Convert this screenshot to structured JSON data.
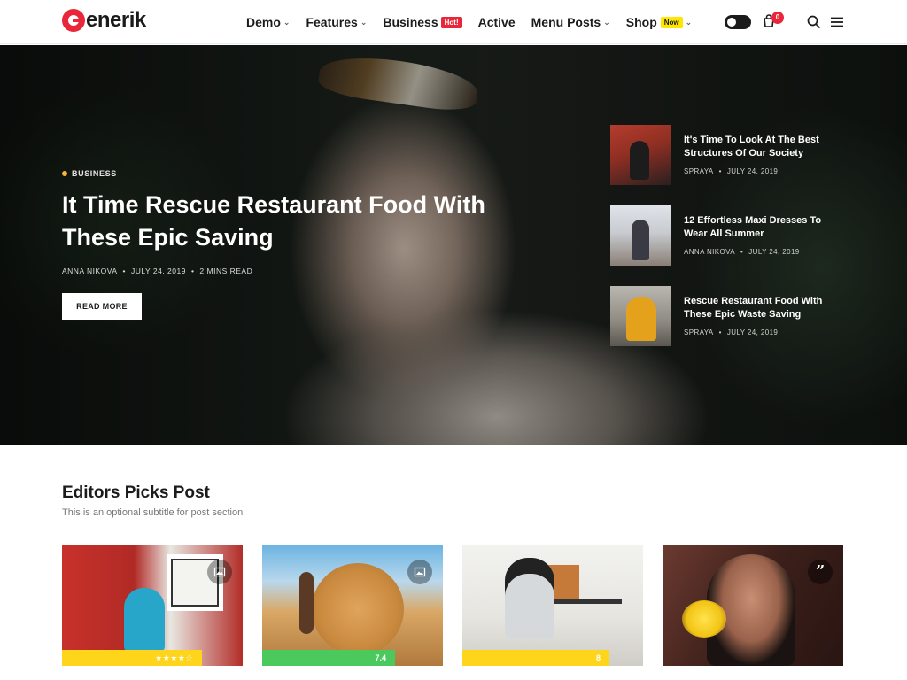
{
  "brand": {
    "name": "enerik",
    "accent": "#e8283a"
  },
  "nav": {
    "items": [
      {
        "label": "Demo",
        "has_dropdown": true
      },
      {
        "label": "Features",
        "has_dropdown": true
      },
      {
        "label": "Business",
        "badge": "Hot!"
      },
      {
        "label": "Active"
      },
      {
        "label": "Menu Posts",
        "has_dropdown": true
      },
      {
        "label": "Shop",
        "badge": "Now",
        "has_dropdown": true
      }
    ]
  },
  "header_tools": {
    "cart_count": "0",
    "icons": [
      "dark-mode-toggle",
      "cart-icon",
      "search-icon",
      "hamburger-menu-icon"
    ]
  },
  "hero": {
    "category": "Business",
    "title": "It Time Rescue Restaurant Food With These Epic Saving",
    "author": "Anna Nikova",
    "date": "July 24, 2019",
    "read_time": "2 Mins Read",
    "cta": "Read More",
    "category_color": "#f7b733"
  },
  "side_posts": [
    {
      "title": "It's Time To Look At The Best Structures Of Our Society",
      "author": "Spraya",
      "date": "July 24, 2019"
    },
    {
      "title": "12 Effortless Maxi Dresses To Wear All Summer",
      "author": "Anna Nikova",
      "date": "July 24, 2019"
    },
    {
      "title": "Rescue Restaurant Food With These Epic Waste Saving",
      "author": "Spraya",
      "date": "July 24, 2019"
    }
  ],
  "editors_picks": {
    "title": "Editors Picks Post",
    "subtitle": "This is an optional subtitle for post section",
    "cards": [
      {
        "format_icon": "image-gallery-icon",
        "rating_type": "stars",
        "rating": "4 of 5 stars",
        "stars_filled": 4,
        "stars_total": 5,
        "bar_color": "#ffd51c"
      },
      {
        "format_icon": "image-gallery-icon",
        "rating_type": "score",
        "rating": "7.4",
        "bar_color": "#4cc95c"
      },
      {
        "format_icon": null,
        "rating_type": "score",
        "rating": "8",
        "bar_color": "#ffd51c"
      },
      {
        "format_icon": "quote-icon",
        "rating_type": null
      }
    ]
  }
}
